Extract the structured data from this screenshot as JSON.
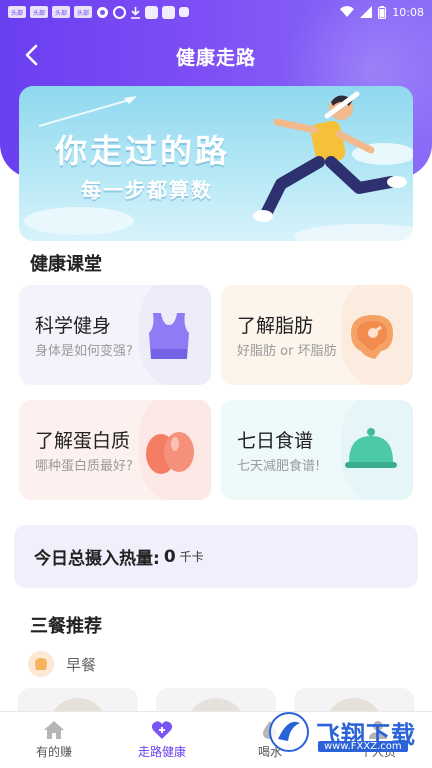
{
  "status_bar": {
    "badges": [
      "头部",
      "头部",
      "头部",
      "头部"
    ],
    "time": "10:08"
  },
  "header": {
    "title": "健康走路"
  },
  "banner": {
    "title": "你走过的路",
    "subtitle": "每一步都算数"
  },
  "course_section": {
    "title": "健康课堂"
  },
  "cards": [
    {
      "title": "科学健身",
      "subtitle": "身体是如何变强?",
      "icon": "vest-icon",
      "bg": "#f3f4fb"
    },
    {
      "title": "了解脂肪",
      "subtitle": "好脂肪 or 坏脂肪",
      "icon": "steak-icon",
      "bg": "#fdf4ec"
    },
    {
      "title": "了解蛋白质",
      "subtitle": "哪种蛋白质最好?",
      "icon": "eggs-icon",
      "bg": "#fdf1ef"
    },
    {
      "title": "七日食谱",
      "subtitle": "七天减肥食谱!",
      "icon": "cloche-icon",
      "bg": "#eef9fa"
    }
  ],
  "calorie": {
    "label": "今日总摄入热量:",
    "value": "0",
    "unit": "千卡"
  },
  "meals_section": {
    "title": "三餐推荐",
    "current_meal": "早餐"
  },
  "bottom_nav": [
    {
      "label": "有的赚",
      "icon": "home-icon"
    },
    {
      "label": "走路健康",
      "icon": "heart-plus-icon",
      "active": true
    },
    {
      "label": "喝水",
      "icon": "water-icon"
    },
    {
      "label": "个人页",
      "icon": "person-icon"
    }
  ],
  "watermark": {
    "text": "飞翔下载",
    "url": "www.FXXZ.com"
  },
  "colors": {
    "primary": "#6a3ff0",
    "banner_sky": "#8fd8ef"
  }
}
